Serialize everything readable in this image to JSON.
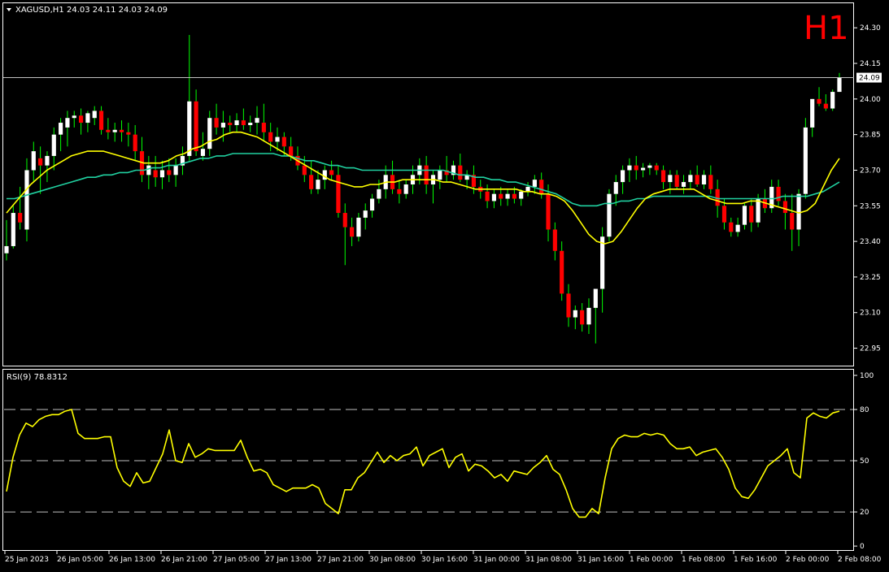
{
  "header": {
    "symbol_label": "XAGUSD,H1",
    "ohlc_label": "24.03 24.11 24.03 24.09",
    "timeframe_badge": "H1",
    "rsi_label": "RSI(9) 78.8312",
    "current_price_label": "24.09"
  },
  "colors": {
    "background": "#000000",
    "frame": "#ffffff",
    "bull": "#ffffff",
    "bear": "#ff0000",
    "wick": "#00ff00",
    "ma_fast": "#ffff00",
    "ma_slow": "#20d0a0",
    "rsi": "#ffff00",
    "badge": "#ff0000"
  },
  "chart_data": [
    {
      "type": "candlestick",
      "symbol": "XAGUSD",
      "timeframe": "H1",
      "ylim": [
        22.88,
        24.4
      ],
      "yticks": [
        "24.30",
        "24.15",
        "24.00",
        "23.85",
        "23.70",
        "23.55",
        "23.40",
        "23.25",
        "23.10",
        "22.95"
      ],
      "last_price": 24.09,
      "candles": [
        [
          23.35,
          23.49,
          23.32,
          23.38
        ],
        [
          23.38,
          23.55,
          23.37,
          23.52
        ],
        [
          23.52,
          23.63,
          23.45,
          23.48
        ],
        [
          23.45,
          23.75,
          23.4,
          23.7
        ],
        [
          23.7,
          23.82,
          23.65,
          23.78
        ],
        [
          23.75,
          23.8,
          23.6,
          23.72
        ],
        [
          23.72,
          23.78,
          23.65,
          23.76
        ],
        [
          23.76,
          23.88,
          23.7,
          23.85
        ],
        [
          23.85,
          23.92,
          23.78,
          23.9
        ],
        [
          23.88,
          23.95,
          23.8,
          23.92
        ],
        [
          23.92,
          23.95,
          23.88,
          23.93
        ],
        [
          23.93,
          23.96,
          23.85,
          23.9
        ],
        [
          23.9,
          23.95,
          23.86,
          23.94
        ],
        [
          23.92,
          23.97,
          23.89,
          23.95
        ],
        [
          23.95,
          23.97,
          23.85,
          23.87
        ],
        [
          23.87,
          23.92,
          23.83,
          23.86
        ],
        [
          23.86,
          23.9,
          23.82,
          23.87
        ],
        [
          23.87,
          23.91,
          23.82,
          23.86
        ],
        [
          23.86,
          23.9,
          23.8,
          23.85
        ],
        [
          23.85,
          23.89,
          23.74,
          23.78
        ],
        [
          23.78,
          23.84,
          23.65,
          23.68
        ],
        [
          23.68,
          23.76,
          23.62,
          23.72
        ],
        [
          23.7,
          23.76,
          23.63,
          23.67
        ],
        [
          23.67,
          23.74,
          23.62,
          23.7
        ],
        [
          23.7,
          23.75,
          23.65,
          23.68
        ],
        [
          23.68,
          23.75,
          23.63,
          23.72
        ],
        [
          23.72,
          23.8,
          23.68,
          23.76
        ],
        [
          23.76,
          24.27,
          23.74,
          23.99
        ],
        [
          23.99,
          24.04,
          23.76,
          23.78
        ],
        [
          23.76,
          23.86,
          23.74,
          23.79
        ],
        [
          23.79,
          23.95,
          23.76,
          23.92
        ],
        [
          23.92,
          23.98,
          23.85,
          23.88
        ],
        [
          23.88,
          23.95,
          23.82,
          23.9
        ],
        [
          23.9,
          23.93,
          23.86,
          23.89
        ],
        [
          23.89,
          23.94,
          23.86,
          23.91
        ],
        [
          23.91,
          23.96,
          23.87,
          23.89
        ],
        [
          23.89,
          23.93,
          23.86,
          23.9
        ],
        [
          23.9,
          23.97,
          23.85,
          23.92
        ],
        [
          23.9,
          23.98,
          23.82,
          23.86
        ],
        [
          23.86,
          23.9,
          23.78,
          23.82
        ],
        [
          23.82,
          23.88,
          23.78,
          23.84
        ],
        [
          23.84,
          23.86,
          23.76,
          23.8
        ],
        [
          23.8,
          23.84,
          23.74,
          23.76
        ],
        [
          23.76,
          23.8,
          23.7,
          23.72
        ],
        [
          23.72,
          23.76,
          23.65,
          23.68
        ],
        [
          23.68,
          23.74,
          23.6,
          23.62
        ],
        [
          23.62,
          23.7,
          23.6,
          23.66
        ],
        [
          23.66,
          23.72,
          23.62,
          23.7
        ],
        [
          23.7,
          23.74,
          23.66,
          23.68
        ],
        [
          23.68,
          23.72,
          23.5,
          23.52
        ],
        [
          23.52,
          23.56,
          23.3,
          23.46
        ],
        [
          23.46,
          23.5,
          23.38,
          23.42
        ],
        [
          23.42,
          23.52,
          23.4,
          23.5
        ],
        [
          23.5,
          23.56,
          23.45,
          23.53
        ],
        [
          23.53,
          23.6,
          23.5,
          23.58
        ],
        [
          23.58,
          23.66,
          23.56,
          23.62
        ],
        [
          23.62,
          23.72,
          23.58,
          23.68
        ],
        [
          23.68,
          23.74,
          23.6,
          23.62
        ],
        [
          23.62,
          23.66,
          23.56,
          23.6
        ],
        [
          23.6,
          23.66,
          23.58,
          23.64
        ],
        [
          23.64,
          23.72,
          23.6,
          23.68
        ],
        [
          23.68,
          23.75,
          23.64,
          23.72
        ],
        [
          23.72,
          23.76,
          23.6,
          23.64
        ],
        [
          23.64,
          23.7,
          23.56,
          23.68
        ],
        [
          23.66,
          23.72,
          23.62,
          23.7
        ],
        [
          23.7,
          23.76,
          23.65,
          23.68
        ],
        [
          23.68,
          23.74,
          23.66,
          23.72
        ],
        [
          23.72,
          23.77,
          23.65,
          23.66
        ],
        [
          23.66,
          23.7,
          23.62,
          23.68
        ],
        [
          23.68,
          23.72,
          23.6,
          23.63
        ],
        [
          23.63,
          23.66,
          23.58,
          23.61
        ],
        [
          23.61,
          23.64,
          23.54,
          23.57
        ],
        [
          23.57,
          23.62,
          23.54,
          23.6
        ],
        [
          23.6,
          23.63,
          23.55,
          23.58
        ],
        [
          23.58,
          23.62,
          23.55,
          23.6
        ],
        [
          23.6,
          23.63,
          23.56,
          23.58
        ],
        [
          23.58,
          23.62,
          23.55,
          23.61
        ],
        [
          23.61,
          23.65,
          23.59,
          23.63
        ],
        [
          23.63,
          23.68,
          23.6,
          23.66
        ],
        [
          23.66,
          23.69,
          23.58,
          23.6
        ],
        [
          23.6,
          23.64,
          23.4,
          23.45
        ],
        [
          23.45,
          23.48,
          23.32,
          23.36
        ],
        [
          23.36,
          23.4,
          23.15,
          23.18
        ],
        [
          23.18,
          23.22,
          23.04,
          23.08
        ],
        [
          23.08,
          23.13,
          23.03,
          23.11
        ],
        [
          23.11,
          23.14,
          23.02,
          23.05
        ],
        [
          23.05,
          23.16,
          23.01,
          23.12
        ],
        [
          23.12,
          23.18,
          22.97,
          23.2
        ],
        [
          23.2,
          23.46,
          23.1,
          23.42
        ],
        [
          23.42,
          23.62,
          23.4,
          23.6
        ],
        [
          23.6,
          23.68,
          23.55,
          23.65
        ],
        [
          23.65,
          23.72,
          23.6,
          23.7
        ],
        [
          23.7,
          23.75,
          23.65,
          23.72
        ],
        [
          23.72,
          23.76,
          23.66,
          23.7
        ],
        [
          23.7,
          23.73,
          23.67,
          23.71
        ],
        [
          23.71,
          23.73,
          23.68,
          23.72
        ],
        [
          23.72,
          23.73,
          23.68,
          23.7
        ],
        [
          23.7,
          23.72,
          23.62,
          23.65
        ],
        [
          23.65,
          23.7,
          23.6,
          23.68
        ],
        [
          23.68,
          23.7,
          23.62,
          23.63
        ],
        [
          23.63,
          23.68,
          23.6,
          23.65
        ],
        [
          23.65,
          23.7,
          23.62,
          23.68
        ],
        [
          23.68,
          23.72,
          23.63,
          23.64
        ],
        [
          23.64,
          23.7,
          23.62,
          23.68
        ],
        [
          23.68,
          23.72,
          23.6,
          23.62
        ],
        [
          23.62,
          23.66,
          23.5,
          23.55
        ],
        [
          23.55,
          23.58,
          23.45,
          23.48
        ],
        [
          23.48,
          23.5,
          23.42,
          23.44
        ],
        [
          23.44,
          23.5,
          23.42,
          23.47
        ],
        [
          23.47,
          23.56,
          23.45,
          23.55
        ],
        [
          23.55,
          23.58,
          23.44,
          23.48
        ],
        [
          23.48,
          23.6,
          23.46,
          23.58
        ],
        [
          23.58,
          23.62,
          23.52,
          23.54
        ],
        [
          23.54,
          23.66,
          23.52,
          23.63
        ],
        [
          23.63,
          23.66,
          23.55,
          23.57
        ],
        [
          23.57,
          23.6,
          23.45,
          23.52
        ],
        [
          23.52,
          23.6,
          23.36,
          23.45
        ],
        [
          23.45,
          23.62,
          23.38,
          23.6
        ],
        [
          23.6,
          23.92,
          23.58,
          23.88
        ],
        [
          23.88,
          24.0,
          23.84,
          24.0
        ],
        [
          24.0,
          24.05,
          23.97,
          23.98
        ],
        [
          23.98,
          24.02,
          23.95,
          23.96
        ],
        [
          23.96,
          24.04,
          23.95,
          24.03
        ],
        [
          24.03,
          24.11,
          24.03,
          24.09
        ]
      ],
      "ma_fast": [
        23.52,
        23.56,
        23.6,
        23.64,
        23.67,
        23.7,
        23.72,
        23.74,
        23.76,
        23.77,
        23.78,
        23.78,
        23.78,
        23.77,
        23.76,
        23.75,
        23.74,
        23.73,
        23.73,
        23.73,
        23.74,
        23.76,
        23.77,
        23.79,
        23.8,
        23.82,
        23.83,
        23.85,
        23.86,
        23.86,
        23.85,
        23.84,
        23.82,
        23.8,
        23.78,
        23.76,
        23.74,
        23.72,
        23.7,
        23.68,
        23.66,
        23.65,
        23.64,
        23.63,
        23.63,
        23.64,
        23.64,
        23.65,
        23.65,
        23.66,
        23.66,
        23.66,
        23.66,
        23.66,
        23.65,
        23.65,
        23.64,
        23.63,
        23.62,
        23.62,
        23.62,
        23.62,
        23.62,
        23.62,
        23.61,
        23.61,
        23.6,
        23.6,
        23.59,
        23.57,
        23.53,
        23.48,
        23.43,
        23.4,
        23.39,
        23.4,
        23.44,
        23.49,
        23.54,
        23.58,
        23.6,
        23.61,
        23.62,
        23.62,
        23.62,
        23.62,
        23.6,
        23.58,
        23.57,
        23.56,
        23.56,
        23.56,
        23.57,
        23.57,
        23.56,
        23.55,
        23.54,
        23.53,
        23.52,
        23.53,
        23.56,
        23.63,
        23.7,
        23.75
      ],
      "ma_slow": [
        23.58,
        23.58,
        23.59,
        23.6,
        23.61,
        23.62,
        23.63,
        23.64,
        23.65,
        23.66,
        23.67,
        23.67,
        23.68,
        23.68,
        23.69,
        23.69,
        23.7,
        23.7,
        23.71,
        23.71,
        23.72,
        23.72,
        23.73,
        23.74,
        23.75,
        23.75,
        23.76,
        23.76,
        23.77,
        23.77,
        23.77,
        23.77,
        23.77,
        23.77,
        23.76,
        23.76,
        23.75,
        23.74,
        23.74,
        23.73,
        23.72,
        23.72,
        23.71,
        23.71,
        23.7,
        23.7,
        23.7,
        23.7,
        23.7,
        23.7,
        23.7,
        23.7,
        23.7,
        23.7,
        23.7,
        23.69,
        23.68,
        23.68,
        23.67,
        23.67,
        23.66,
        23.66,
        23.65,
        23.65,
        23.64,
        23.63,
        23.62,
        23.61,
        23.6,
        23.58,
        23.56,
        23.55,
        23.55,
        23.55,
        23.56,
        23.56,
        23.57,
        23.57,
        23.58,
        23.58,
        23.59,
        23.59,
        23.59,
        23.59,
        23.59,
        23.59,
        23.59,
        23.59,
        23.58,
        23.58,
        23.58,
        23.58,
        23.58,
        23.58,
        23.58,
        23.58,
        23.59,
        23.59,
        23.59,
        23.59,
        23.6,
        23.61,
        23.63,
        23.65
      ]
    },
    {
      "type": "line",
      "name": "RSI(9) 78.8312",
      "ylim": [
        0,
        100
      ],
      "yticks": [
        "100",
        "80",
        "50",
        "20",
        "0"
      ],
      "levels": [
        80,
        50,
        20
      ],
      "values": [
        32,
        52,
        65,
        72,
        70,
        74,
        76,
        77,
        77,
        79,
        80,
        66,
        63,
        63,
        63,
        64,
        64,
        46,
        38,
        35,
        43,
        37,
        38,
        46,
        54,
        68,
        50,
        49,
        60,
        52,
        54,
        57,
        56,
        56,
        56,
        56,
        62,
        52,
        44,
        45,
        43,
        36,
        34,
        32,
        34,
        34,
        34,
        36,
        34,
        25,
        22,
        19,
        33,
        33,
        40,
        43,
        49,
        55,
        49,
        53,
        50,
        53,
        54,
        58,
        47,
        53,
        55,
        57,
        46,
        52,
        54,
        44,
        48,
        47,
        44,
        40,
        42,
        38,
        44,
        43,
        42,
        46,
        49,
        53,
        45,
        42,
        33,
        22,
        17,
        17,
        22,
        19,
        40,
        57,
        63,
        65,
        64,
        64,
        66,
        65,
        66,
        65,
        60,
        57,
        57,
        58,
        53,
        55,
        56,
        57,
        52,
        45,
        34,
        29,
        28,
        33,
        40,
        47,
        50,
        53,
        57,
        43,
        40,
        75,
        78,
        76,
        75,
        78,
        79
      ]
    }
  ],
  "x_axis": {
    "labels": [
      "25 Jan 2023",
      "26 Jan 05:00",
      "26 Jan 13:00",
      "26 Jan 21:00",
      "27 Jan 05:00",
      "27 Jan 13:00",
      "27 Jan 21:00",
      "30 Jan 08:00",
      "30 Jan 16:00",
      "31 Jan 00:00",
      "31 Jan 08:00",
      "31 Jan 16:00",
      "1 Feb 00:00",
      "1 Feb 08:00",
      "1 Feb 16:00",
      "2 Feb 00:00",
      "2 Feb 08:00"
    ]
  }
}
